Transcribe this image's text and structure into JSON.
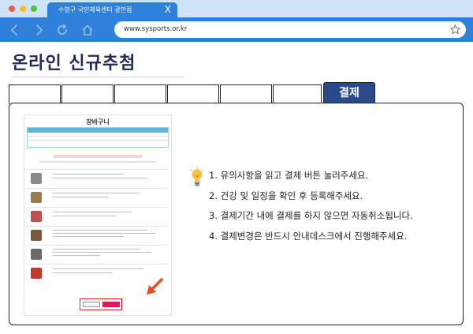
{
  "browser": {
    "tab_title": "수영구 국민체육센터 광안점",
    "tab_close": "X",
    "url": "www.sysports.or.kr"
  },
  "page": {
    "title": "온라인 신규추첨"
  },
  "steps": {
    "active_label": "결제"
  },
  "preview": {
    "logo": "장바구니"
  },
  "instructions": [
    "1. 유의사항을 읽고 결제 버튼 눌러주세요.",
    "2. 건강 및 일정을 확인 후 등록해주세요.",
    "3. 결제기간 내에 결제를 하지 않으면 자동취소됩니다.",
    "4. 결제변경은 반드시 안내데스크에서 진행해주세요."
  ],
  "colors": {
    "browser_blue": "#2f80d8",
    "tabbar_light": "#cfe3f7",
    "title_navy": "#1f2a5a",
    "active_tab": "#2a4a8c",
    "highlight_red": "#e02020"
  }
}
